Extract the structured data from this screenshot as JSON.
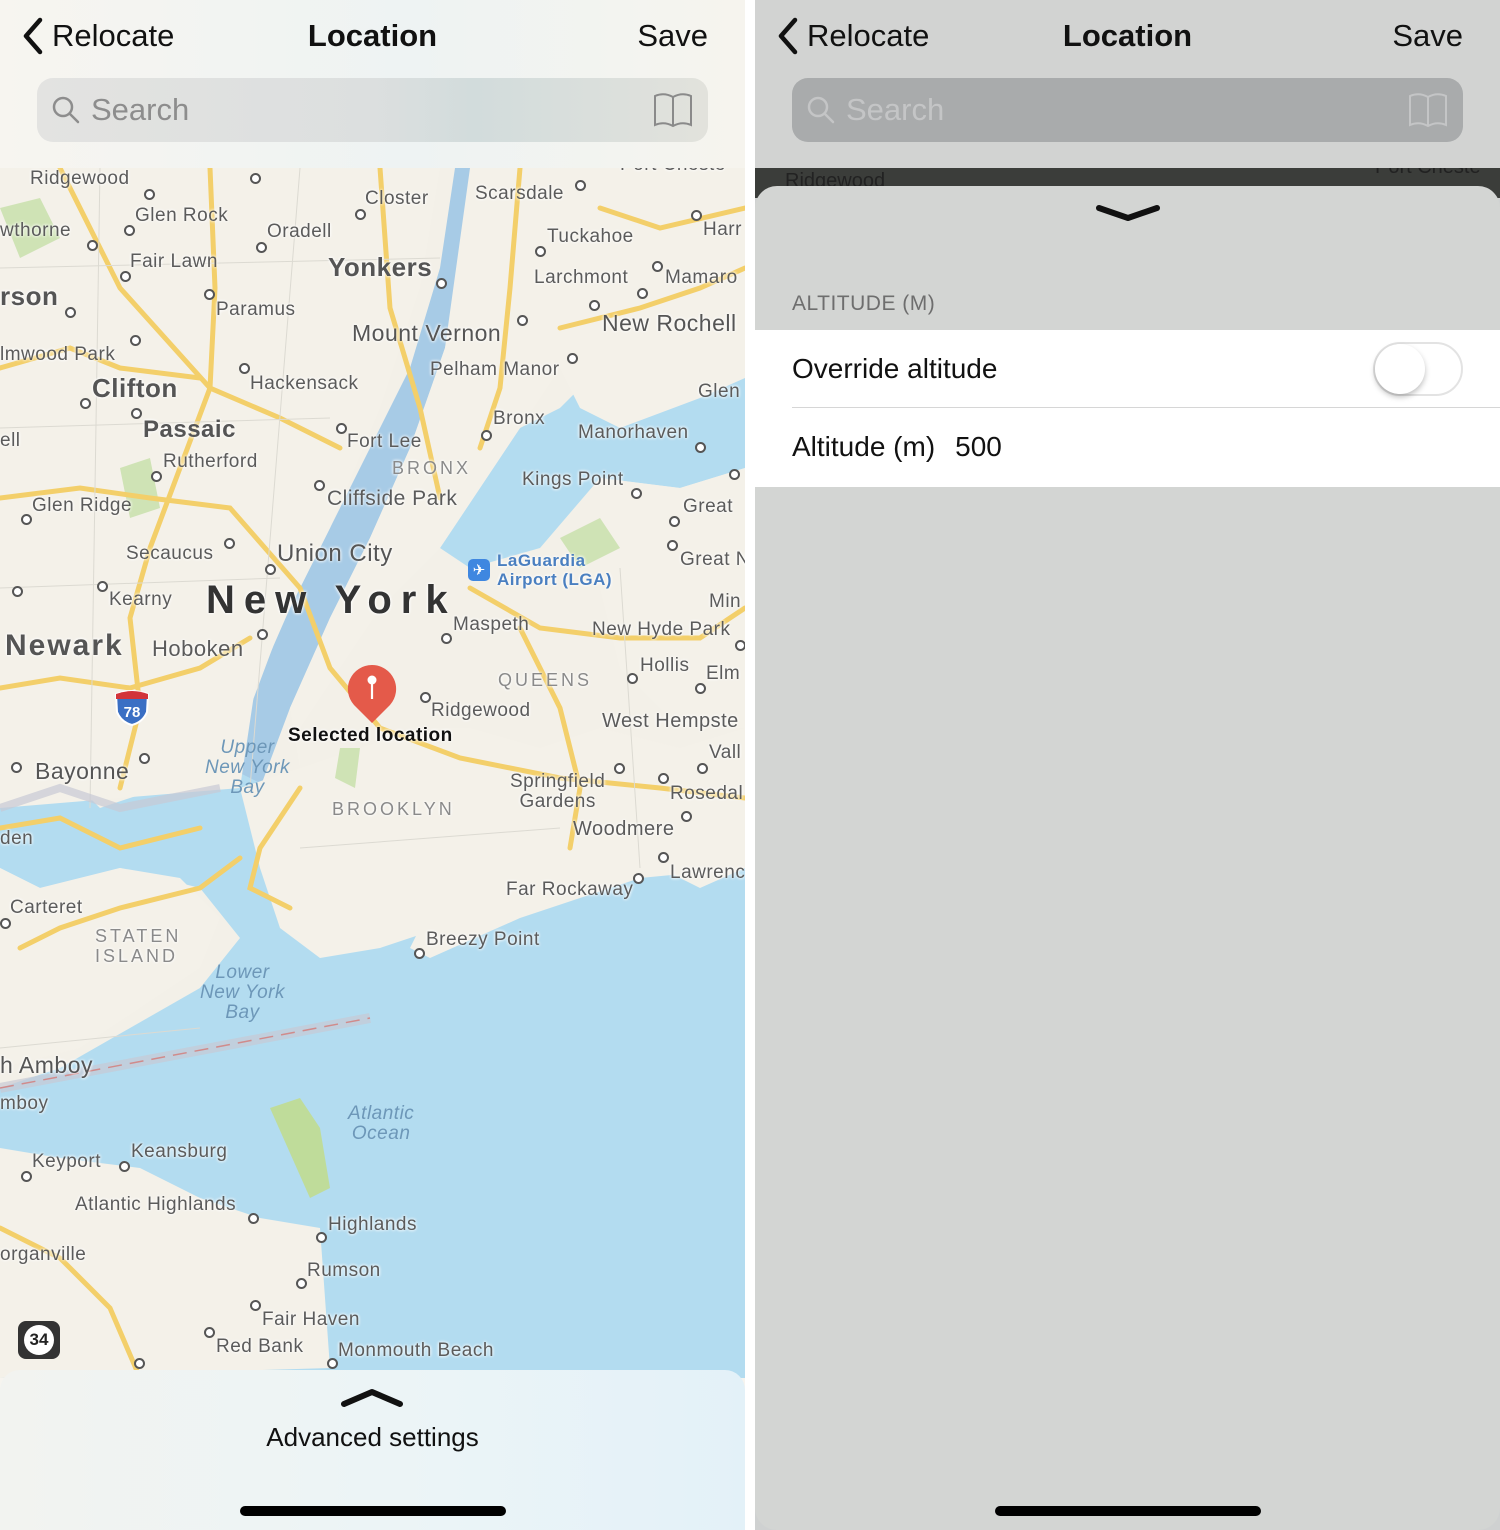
{
  "left": {
    "nav": {
      "back_label": "Relocate",
      "title": "Location",
      "save_label": "Save"
    },
    "search": {
      "placeholder": "Search",
      "value": ""
    },
    "map": {
      "labels": {
        "ridgewood_n": "Ridgewood",
        "glen_rock": "Glen Rock",
        "closter": "Closter",
        "scarsdale": "Scarsdale",
        "port_chester": "Port Cheste",
        "hawthorne": "wthorne",
        "oradell": "Oradell",
        "tuckahoe": "Tuckahoe",
        "harrison": "Harr",
        "fair_lawn": "Fair Lawn",
        "yonkers": "Yonkers",
        "larchmont": "Larchmont",
        "mamaroneck": "Mamaro",
        "paterson": "rson",
        "paramus": "Paramus",
        "mount_vernon": "Mount Vernon",
        "new_rochelle": "New Rochell",
        "elmwood_park": "lmwood Park",
        "pelham_manor": "Pelham Manor",
        "clifton": "Clifton",
        "hackensack": "Hackensack",
        "glen_cove": "Glen",
        "bronx": "Bronx",
        "passaic": "Passaic",
        "manorhaven": "Manorhaven",
        "montclair": "ell",
        "fort_lee": "Fort Lee",
        "rutherford": "Rutherford",
        "bronx_district": "BRONX",
        "kings_point": "Kings Point",
        "cliffside_park": "Cliffside Park",
        "great_neck": "Great",
        "glen_ridge": "Glen Ridge",
        "secaucus": "Secaucus",
        "union_city": "Union City",
        "laguardia": "LaGuardia\nAirport (LGA)",
        "great_neck2": "Great N",
        "kearny": "Kearny",
        "new_york": "New York",
        "mineola": "Min",
        "maspeth": "Maspeth",
        "new_hyde_park": "New Hyde Park",
        "newark": "Newark",
        "hoboken": "Hoboken",
        "hollis": "Hollis",
        "elmont": "Elm",
        "queens": "QUEENS",
        "ridgewood_q": "Ridgewood",
        "west_hempstead": "West Hempste",
        "selected": "Selected location",
        "upper_bay": "Upper\nNew York\nBay",
        "valley_stream": "Vall",
        "bayonne": "Bayonne",
        "springfield": "Springfield\nGardens",
        "rosedale": "Rosedal",
        "brooklyn": "BROOKLYN",
        "woodmere": "Woodmere",
        "linden": "den",
        "lawrence": "Lawrenc",
        "far_rockaway": "Far Rockaway",
        "carteret": "Carteret",
        "staten_island": "STATEN\nISLAND",
        "breezy_point": "Breezy Point",
        "lower_bay": "Lower\nNew York\nBay",
        "perth_amboy": "h Amboy",
        "south_amboy": "mboy",
        "atlantic_ocean": "Atlantic\nOcean",
        "keyport": "Keyport",
        "keansburg": "Keansburg",
        "atlantic_highlands": "Atlantic Highlands",
        "highlands": "Highlands",
        "morganville": "organville",
        "rumson": "Rumson",
        "fair_haven": "Fair Haven",
        "red_bank": "Red Bank",
        "monmouth_beach": "Monmouth Beach"
      },
      "route_shields": {
        "interstate": "78",
        "state": "34"
      }
    },
    "sheet": {
      "label": "Advanced settings"
    }
  },
  "right": {
    "nav": {
      "back_label": "Relocate",
      "title": "Location",
      "save_label": "Save"
    },
    "search": {
      "placeholder": "Search",
      "value": ""
    },
    "map_peek": {
      "label_left": "Ridgewood",
      "label_right": "Port Cheste"
    },
    "section_header": "ALTITUDE (M)",
    "override": {
      "label": "Override altitude",
      "enabled": false
    },
    "altitude": {
      "label": "Altitude (m)",
      "value": "500"
    }
  }
}
